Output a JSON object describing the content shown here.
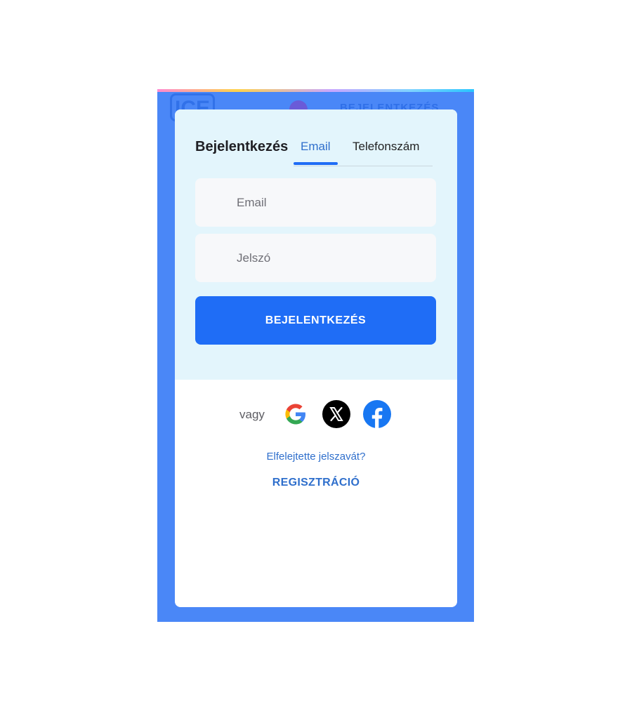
{
  "background": {
    "logo_text": "ICE",
    "header_login_text": "BEJELENTKEZÉS"
  },
  "modal": {
    "title": "Bejelentkezés",
    "tabs": [
      {
        "label": "Email",
        "active": true
      },
      {
        "label": "Telefonszám",
        "active": false
      }
    ],
    "email_placeholder": "Email",
    "password_placeholder": "Jelszó",
    "login_button": "BEJELENTKEZÉS",
    "or_text": "vagy",
    "social_icons": [
      "google-icon",
      "x-icon",
      "facebook-icon"
    ],
    "forgot_password": "Elfelejtette jelszavát?",
    "register": "REGISZTRÁCIÓ"
  },
  "colors": {
    "page_background": "#4a87f7",
    "modal_top": "#e3f5fc",
    "primary": "#1f6df6",
    "link": "#2f6fcc"
  }
}
